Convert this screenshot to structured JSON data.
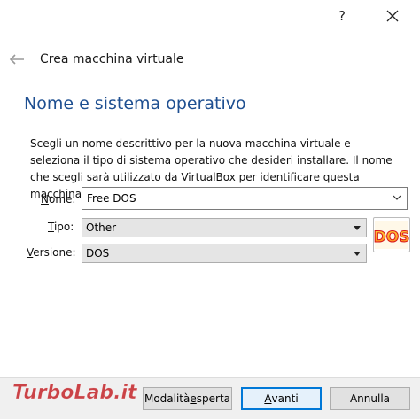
{
  "window": {
    "help_label": "?",
    "close_icon": "close-icon"
  },
  "wizard": {
    "title": "Crea macchina virtuale",
    "heading": "Nome e sistema operativo",
    "description": "Scegli un nome descrittivo per la nuova macchina virtuale e seleziona il tipo di sistema operativo che desideri installare. Il nome che scegli sarà utilizzato da VirtualBox per identificare questa macchina."
  },
  "form": {
    "name": {
      "label_mnemonic": "N",
      "label_rest": "ome:",
      "value": "Free DOS"
    },
    "type": {
      "label_mnemonic": "T",
      "label_rest": "ipo:",
      "value": "Other"
    },
    "version": {
      "label_mnemonic": "V",
      "label_rest": "ersione:",
      "value": "DOS"
    },
    "os_icon_text": "DOS"
  },
  "footer": {
    "expert_pre": "Modalità ",
    "expert_mnemonic": "e",
    "expert_post": "sperta",
    "next_pre": "",
    "next_mnemonic": "A",
    "next_post": "vanti",
    "cancel_label": "Annulla"
  },
  "watermark": {
    "text": "TurboLab.it"
  },
  "colors": {
    "heading": "#1e4f91",
    "default_button_border": "#0078d7",
    "watermark_red": "#c0161b"
  }
}
